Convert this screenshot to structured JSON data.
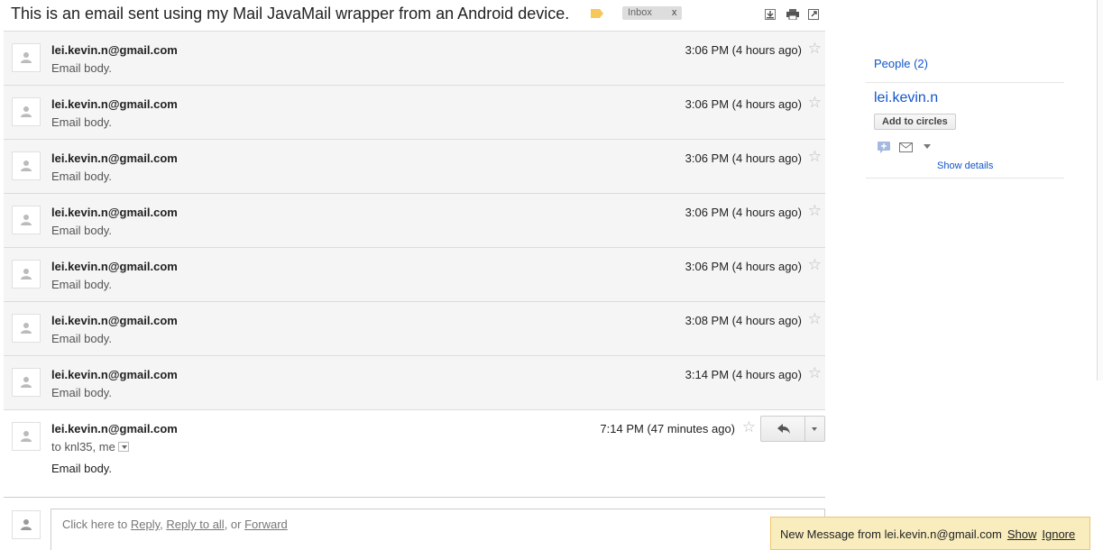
{
  "subject": "This is an email sent using my Mail JavaMail wrapper from an Android device.",
  "inbox_chip": {
    "label": "Inbox",
    "remove": "x"
  },
  "messages": [
    {
      "sender": "lei.kevin.n@gmail.com",
      "snippet": "Email body.",
      "time": "3:06 PM (4 hours ago)"
    },
    {
      "sender": "lei.kevin.n@gmail.com",
      "snippet": "Email body.",
      "time": "3:06 PM (4 hours ago)"
    },
    {
      "sender": "lei.kevin.n@gmail.com",
      "snippet": "Email body.",
      "time": "3:06 PM (4 hours ago)"
    },
    {
      "sender": "lei.kevin.n@gmail.com",
      "snippet": "Email body.",
      "time": "3:06 PM (4 hours ago)"
    },
    {
      "sender": "lei.kevin.n@gmail.com",
      "snippet": "Email body.",
      "time": "3:06 PM (4 hours ago)"
    },
    {
      "sender": "lei.kevin.n@gmail.com",
      "snippet": "Email body.",
      "time": "3:08 PM (4 hours ago)"
    },
    {
      "sender": "lei.kevin.n@gmail.com",
      "snippet": "Email body.",
      "time": "3:14 PM (4 hours ago)"
    }
  ],
  "expanded": {
    "sender": "lei.kevin.n@gmail.com",
    "to": "to knl35, me",
    "body": "Email body.",
    "time": "7:14 PM (47 minutes ago)"
  },
  "reply_prompt": {
    "prefix": "Click here to ",
    "reply": "Reply",
    "sep1": ", ",
    "reply_all": "Reply to all",
    "sep2": ", or ",
    "forward": "Forward"
  },
  "people": {
    "title": "People (2)",
    "contact_name": "lei.kevin.n",
    "add_circles": "Add to circles",
    "show_details": "Show details"
  },
  "notification": {
    "text": "New Message from lei.kevin.n@gmail.com",
    "show": "Show",
    "ignore": "Ignore"
  },
  "colors": {
    "link": "#1155cc",
    "notification_bg": "#f9edbe",
    "label_yellow": "#f6c85a"
  }
}
